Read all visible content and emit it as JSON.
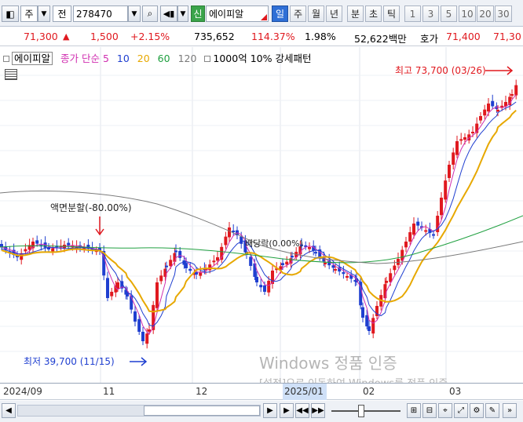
{
  "toolbar": {
    "type_label": "주",
    "sub_label": "전",
    "code": "278470",
    "stock_name": "에이피알",
    "badge": "신",
    "periods": [
      "일",
      "주",
      "월",
      "년",
      "분",
      "초",
      "틱"
    ],
    "active_period": "일",
    "numbers": [
      "1",
      "3",
      "5",
      "10",
      "20",
      "30"
    ]
  },
  "quote": {
    "price": "71,300",
    "change": "1,500",
    "change_pct": "+2.15%",
    "volume": "735,652",
    "vol_ratio": "114.37%",
    "turnover": "1.98%",
    "amount": "52,622백만",
    "ask_label": "호가",
    "ask": "71,400",
    "bid": "71,30"
  },
  "legend": {
    "name": "에이피알",
    "ma_label": "종가 단순 5",
    "ma10": "10",
    "ma20": "20",
    "ma60": "60",
    "ma120": "120",
    "extra": "1000억 10% 강세패턴"
  },
  "annotations": {
    "high": "최고 73,700 (03/26)",
    "low": "최저 39,700 (11/15)",
    "split": "액면분할(-80.00%)",
    "rights": "배당락(0.00%)"
  },
  "timeaxis": {
    "labels": [
      "2024/09",
      "11",
      "12",
      "2025/01",
      "02",
      "03"
    ]
  },
  "watermark": {
    "line1": "Windows 정품 인증",
    "line2": "[설정]으로 이동하여 Windows를 정품 인증"
  },
  "colors": {
    "up": "#e0191f",
    "down": "#1f3fd0",
    "ma5": "#d02fb0",
    "ma10": "#1f3fd0",
    "ma20": "#e7a800",
    "ma60": "#20a040",
    "ma120": "#7a7a7a"
  }
}
